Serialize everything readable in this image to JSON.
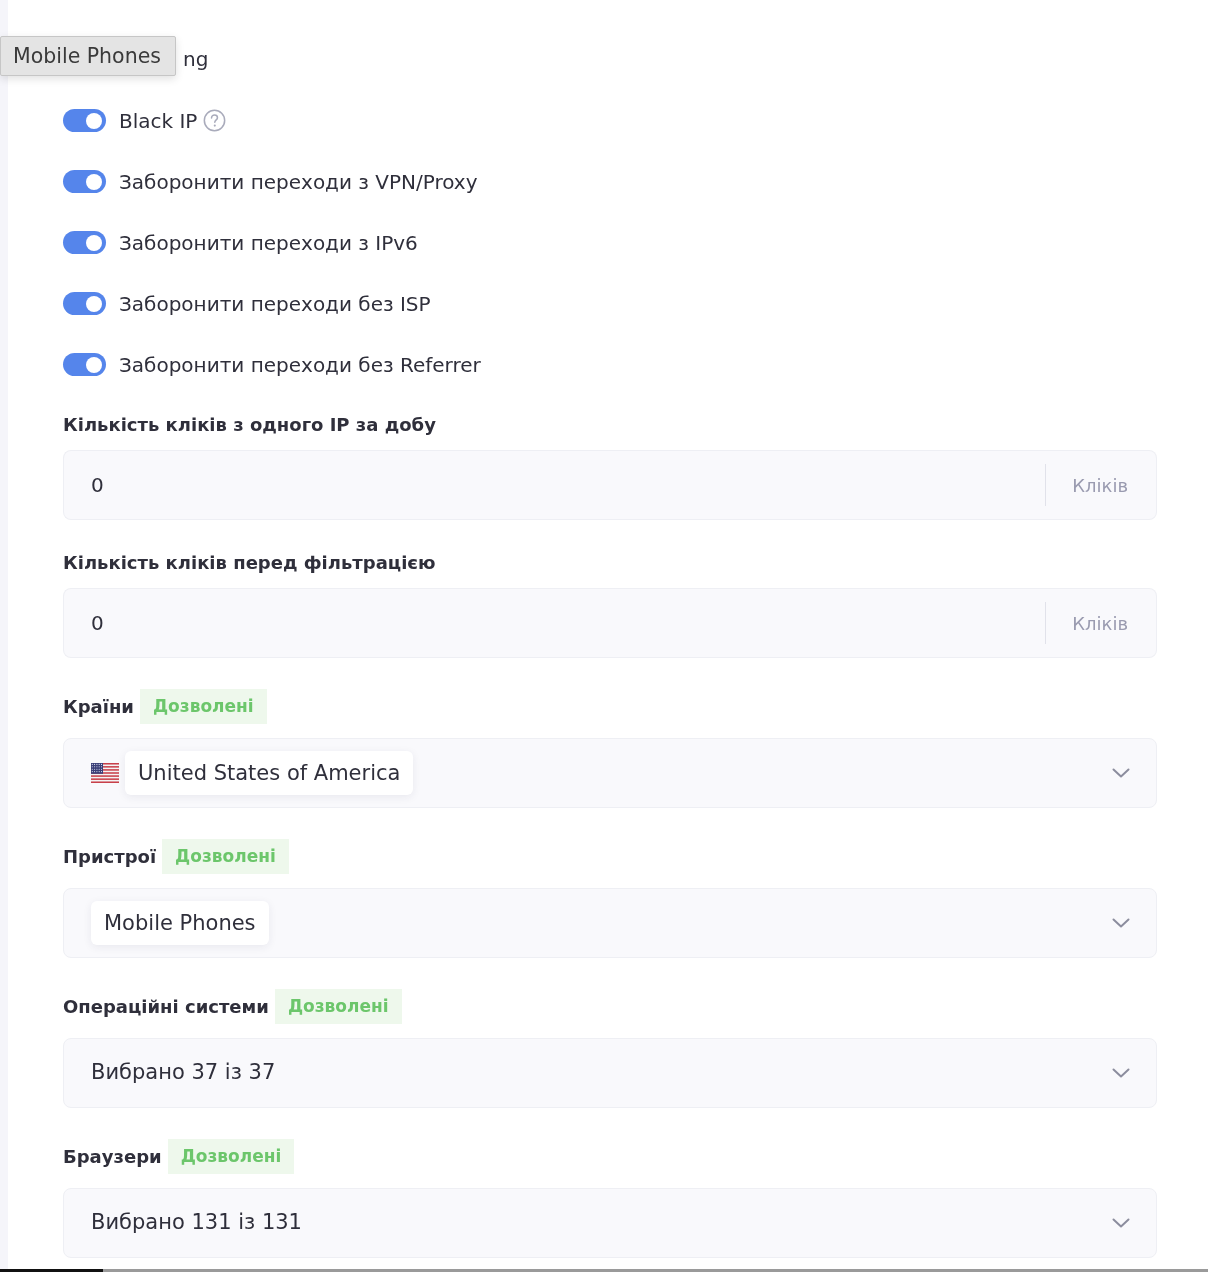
{
  "tooltip": {
    "text": "Mobile Phones"
  },
  "section": {
    "heading": "ng"
  },
  "toggles": [
    {
      "label": "Black IP",
      "on": true,
      "help_icon": true
    },
    {
      "label": "Заборонити переходи з VPN/Proxy",
      "on": true,
      "help_icon": false
    },
    {
      "label": "Заборонити переходи з IPv6",
      "on": true,
      "help_icon": false
    },
    {
      "label": "Заборонити переходи без ISP",
      "on": true,
      "help_icon": false
    },
    {
      "label": "Заборонити переходи без Referrer",
      "on": true,
      "help_icon": false
    }
  ],
  "number_fields": [
    {
      "label": "Кількість кліків з одного IP за добу",
      "value": "0",
      "suffix": "Кліків"
    },
    {
      "label": "Кількість кліків перед фільтрацією",
      "value": "0",
      "suffix": "Кліків"
    }
  ],
  "selects": [
    {
      "label": "Країни",
      "badge": "Дозволені",
      "kind": "chips",
      "chips": [
        {
          "kind": "country",
          "text": "United States of America"
        }
      ]
    },
    {
      "label": "Пристрої",
      "badge": "Дозволені",
      "kind": "chips",
      "chips": [
        {
          "kind": "device",
          "text": "Mobile Phones"
        }
      ]
    },
    {
      "label": "Операційні системи",
      "badge": "Дозволені",
      "kind": "summary",
      "summary": "Вибрано 37 із 37"
    },
    {
      "label": "Браузери",
      "badge": "Дозволені",
      "kind": "summary",
      "summary": "Вибрано 131 із 131"
    }
  ]
}
